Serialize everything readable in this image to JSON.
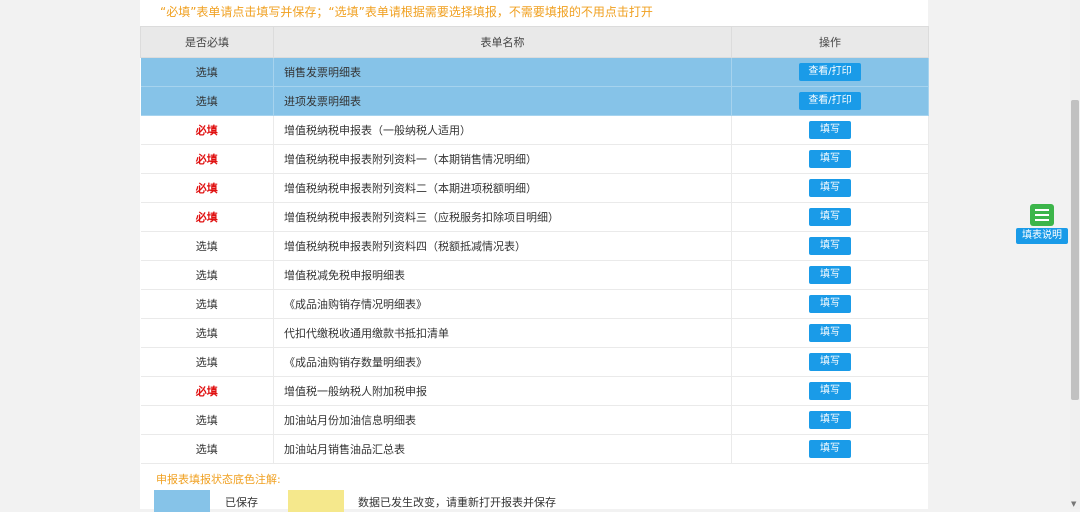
{
  "notice": "“必填”表单请点击填写并保存；“选填”表单请根据需要选择填报，不需要填报的不用点击打开",
  "columns": {
    "required": "是否必填",
    "name": "表单名称",
    "action": "操作"
  },
  "rows": [
    {
      "required": "选填",
      "name": "销售发票明细表",
      "button": "查看/打印",
      "saved": true
    },
    {
      "required": "选填",
      "name": "进项发票明细表",
      "button": "查看/打印",
      "saved": true
    },
    {
      "required": "必填",
      "name": "增值税纳税申报表（一般纳税人适用）",
      "button": "填写"
    },
    {
      "required": "必填",
      "name": "增值税纳税申报表附列资料一（本期销售情况明细）",
      "button": "填写"
    },
    {
      "required": "必填",
      "name": "增值税纳税申报表附列资料二（本期进项税额明细）",
      "button": "填写"
    },
    {
      "required": "必填",
      "name": "增值税纳税申报表附列资料三（应税服务扣除项目明细）",
      "button": "填写"
    },
    {
      "required": "选填",
      "name": "增值税纳税申报表附列资料四（税额抵减情况表）",
      "button": "填写"
    },
    {
      "required": "选填",
      "name": "增值税减免税申报明细表",
      "button": "填写"
    },
    {
      "required": "选填",
      "name": "《成品油购销存情况明细表》",
      "button": "填写"
    },
    {
      "required": "选填",
      "name": "代扣代缴税收通用缴款书抵扣清单",
      "button": "填写"
    },
    {
      "required": "选填",
      "name": "《成品油购销存数量明细表》",
      "button": "填写"
    },
    {
      "required": "必填",
      "name": "增值税一般纳税人附加税申报",
      "button": "填写"
    },
    {
      "required": "选填",
      "name": "加油站月份加油信息明细表",
      "button": "填写"
    },
    {
      "required": "选填",
      "name": "加油站月销售油品汇总表",
      "button": "填写"
    }
  ],
  "legend": {
    "title": "申报表填报状态底色注解:",
    "saved": "已保存",
    "changed": "数据已发生改变，请重新打开报表并保存",
    "colors": {
      "saved": "#86c3e8",
      "changed": "#f5e88c"
    }
  },
  "help_button": {
    "label": "填表说明",
    "icon": "document-icon"
  }
}
